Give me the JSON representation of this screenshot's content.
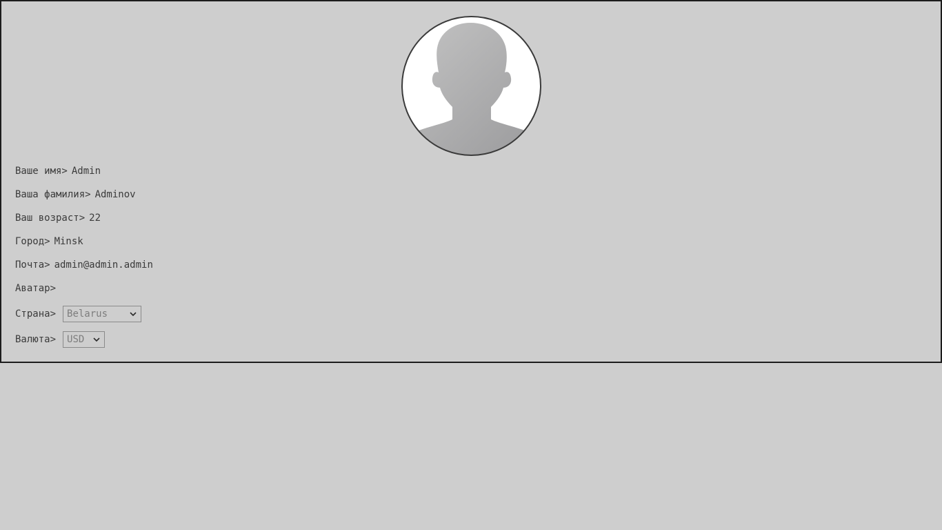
{
  "avatar": {
    "icon": "user-silhouette-icon",
    "border_color": "#3a3a3a",
    "silhouette_color": "#a8a8aa"
  },
  "profile": {
    "first_name": {
      "label": "Ваше имя>",
      "value": "Admin"
    },
    "last_name": {
      "label": "Ваша фамилия>",
      "value": "Adminov"
    },
    "age": {
      "label": "Ваш возраст>",
      "value": "22"
    },
    "city": {
      "label": "Город>",
      "value": "Minsk"
    },
    "email": {
      "label": "Почта>",
      "value": "admin@admin.admin"
    },
    "avatar_label": {
      "label": "Аватар>"
    },
    "country": {
      "label": "Страна>",
      "selected": "Belarus"
    },
    "currency": {
      "label": "Валюта>",
      "selected": "USD"
    }
  }
}
